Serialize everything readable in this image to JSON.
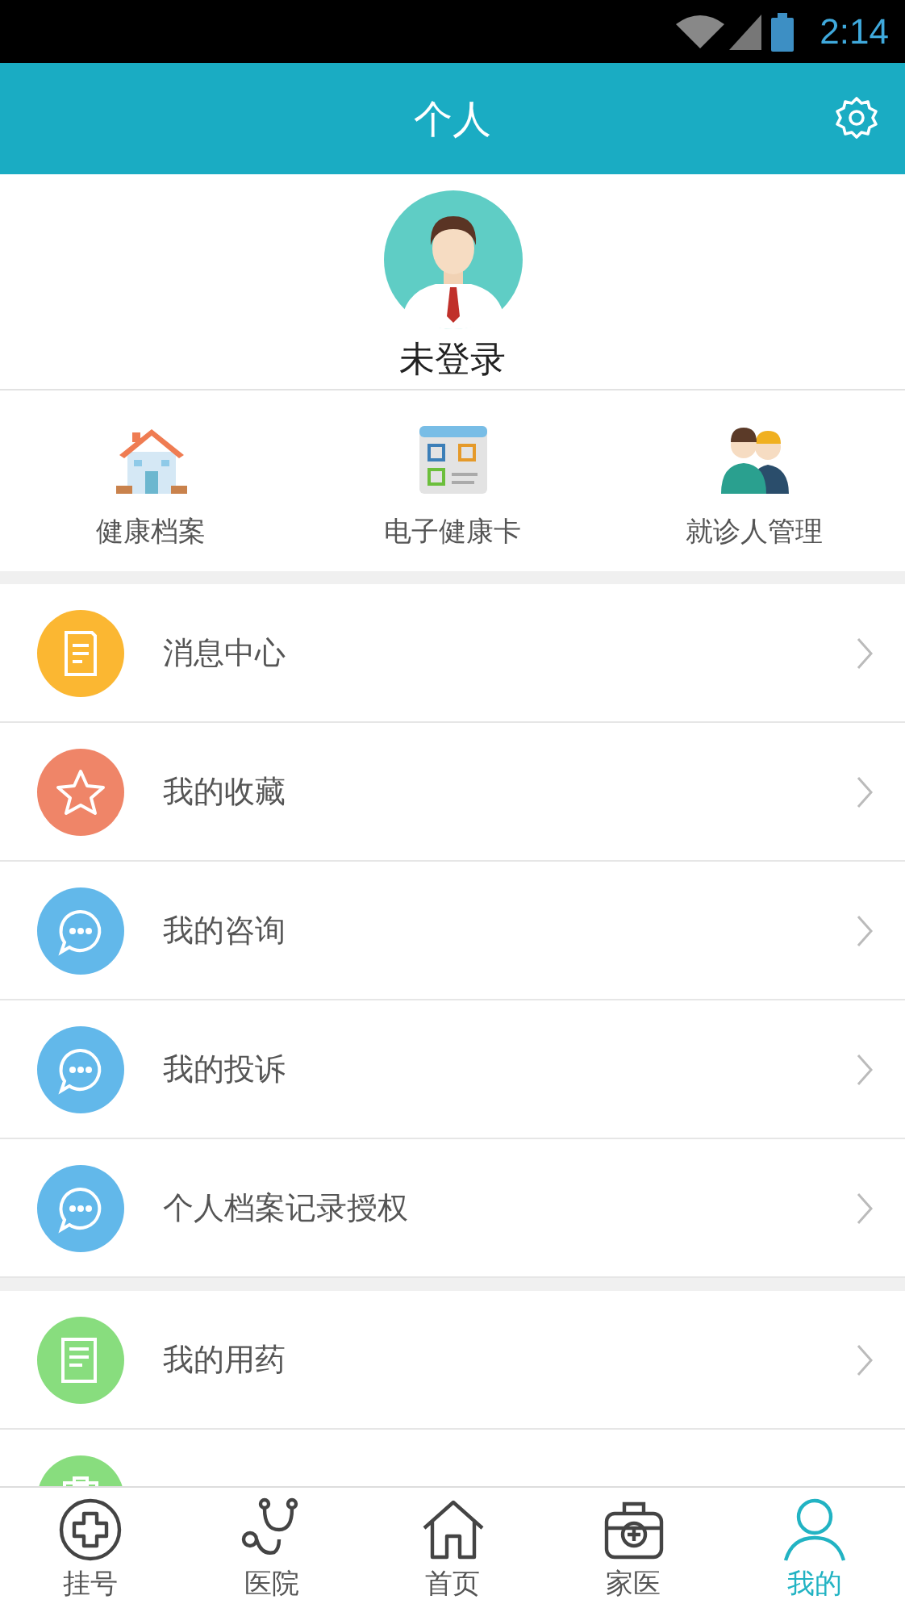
{
  "status_bar": {
    "time": "2:14"
  },
  "header": {
    "title": "个人"
  },
  "profile": {
    "name": "未登录"
  },
  "shortcuts": [
    {
      "label": "健康档案",
      "kind": "house"
    },
    {
      "label": "电子健康卡",
      "kind": "card"
    },
    {
      "label": "就诊人管理",
      "kind": "people"
    }
  ],
  "menu_groups": [
    {
      "items": [
        {
          "label": "消息中心",
          "kind": "document",
          "color": "#fbb732"
        },
        {
          "label": "我的收藏",
          "kind": "star",
          "color": "#ef8568"
        },
        {
          "label": "我的咨询",
          "kind": "chat",
          "color": "#62b8ea"
        },
        {
          "label": "我的投诉",
          "kind": "chat",
          "color": "#62b8ea"
        },
        {
          "label": "个人档案记录授权",
          "kind": "chat",
          "color": "#62b8ea"
        }
      ]
    },
    {
      "items": [
        {
          "label": "我的用药",
          "kind": "prescription",
          "color": "#88dd7e"
        },
        {
          "kind": "clipboard",
          "color": "#88dd7e"
        }
      ]
    }
  ],
  "tab_bar": [
    {
      "label": "挂号",
      "kind": "plus",
      "selected": false
    },
    {
      "label": "医院",
      "kind": "stethoscope",
      "selected": false
    },
    {
      "label": "首页",
      "kind": "home",
      "selected": false
    },
    {
      "label": "家医",
      "kind": "kit",
      "selected": false
    },
    {
      "label": "我的",
      "kind": "person",
      "selected": true
    }
  ]
}
